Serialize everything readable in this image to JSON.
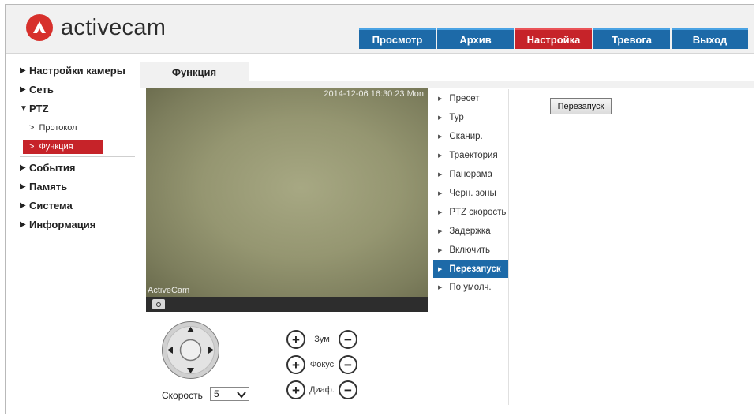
{
  "logo": {
    "text": "activecam",
    "brand_color": "#d7302c"
  },
  "topnav": {
    "tabs": [
      {
        "label": "Просмотр",
        "active": false
      },
      {
        "label": "Архив",
        "active": false
      },
      {
        "label": "Настройка",
        "active": true
      },
      {
        "label": "Тревога",
        "active": false
      },
      {
        "label": "Выход",
        "active": false
      }
    ],
    "color": "#1d6aa8",
    "active_color": "#c62329"
  },
  "sidebar": {
    "items": [
      {
        "label": "Настройки камеры",
        "expanded": false
      },
      {
        "label": "Сеть",
        "expanded": false
      },
      {
        "label": "PTZ",
        "expanded": true
      },
      {
        "label": "События",
        "expanded": false
      },
      {
        "label": "Память",
        "expanded": false
      },
      {
        "label": "Система",
        "expanded": false
      },
      {
        "label": "Информация",
        "expanded": false
      }
    ],
    "ptz_sub": [
      {
        "label": "Протокол",
        "active": false
      },
      {
        "label": "Функция",
        "active": true
      }
    ]
  },
  "content": {
    "tab_label": "Функция"
  },
  "video": {
    "timestamp": "2014-12-06 16:30:23 Mon",
    "watermark": "ActiveCam",
    "snapshot_icon": "camera-icon"
  },
  "ptz": {
    "speed_label": "Скорость",
    "speed_value": "5",
    "zoom_label": "Зум",
    "focus_label": "Фокус",
    "iris_label": "Диаф.",
    "plus": "+",
    "minus": "−"
  },
  "function_menu": [
    {
      "label": "Пресет",
      "active": false
    },
    {
      "label": "Тур",
      "active": false
    },
    {
      "label": "Сканир.",
      "active": false
    },
    {
      "label": "Траектория",
      "active": false
    },
    {
      "label": "Панорама",
      "active": false
    },
    {
      "label": "Черн. зоны",
      "active": false
    },
    {
      "label": "PTZ скорость",
      "active": false
    },
    {
      "label": "Задержка",
      "active": false
    },
    {
      "label": "Включить",
      "active": false
    },
    {
      "label": "Перезапуск",
      "active": true
    },
    {
      "label": "По умолч.",
      "active": false
    }
  ],
  "action_button": {
    "label": "Перезапуск"
  }
}
